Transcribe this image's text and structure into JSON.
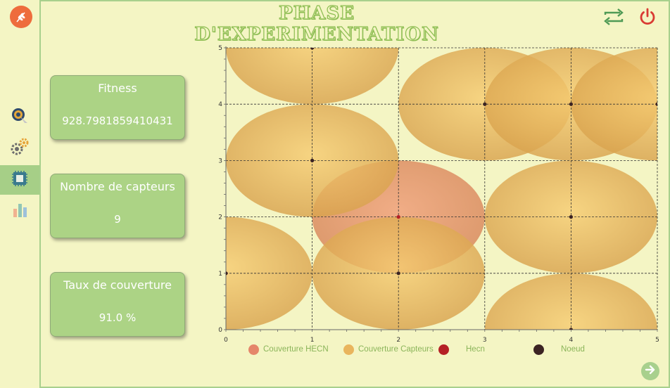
{
  "header": {
    "title": "PHASE D'EXPERIMENTATION"
  },
  "icons": {
    "logo": "wheat-logo-icon",
    "swap": "swap-arrows-icon",
    "power": "power-icon",
    "next": "arrow-right-icon"
  },
  "sidebar": {
    "items": [
      {
        "icon": "target-icon",
        "active": false
      },
      {
        "icon": "gears-icon",
        "active": false
      },
      {
        "icon": "chip-icon",
        "active": true
      },
      {
        "icon": "bar-chart-icon",
        "active": false
      }
    ]
  },
  "stats": {
    "fitness": {
      "label": "Fitness",
      "value": "928.7981859410431"
    },
    "sensors": {
      "label": "Nombre de capteurs",
      "value": "9"
    },
    "coverage": {
      "label": "Taux de couverture",
      "value": "91.0 %"
    }
  },
  "colors": {
    "accent": "#a8d08d",
    "background": "#f4f5c4",
    "card": "#acd385",
    "hecn_coverage": "#e5866a",
    "sensor_coverage": "#e9b55d",
    "hecn": "#b52025",
    "node": "#3b2323"
  },
  "chart_data": {
    "type": "scatter",
    "xlim": [
      0,
      5
    ],
    "ylim": [
      0,
      5
    ],
    "xticks": [
      "0",
      "1",
      "2",
      "3",
      "4",
      "5"
    ],
    "yticks": [
      "0",
      "1",
      "2",
      "3",
      "4",
      "5"
    ],
    "grid": true,
    "legend_position": "bottom",
    "coverage_radius": 1,
    "series": [
      {
        "name": "Couverture HECN",
        "kind": "coverage",
        "points": [
          [
            2,
            2
          ]
        ]
      },
      {
        "name": "Couverture Capteurs",
        "kind": "coverage",
        "points": [
          [
            1,
            5
          ],
          [
            1,
            3
          ],
          [
            0,
            1
          ],
          [
            2,
            1
          ],
          [
            3,
            4
          ],
          [
            4,
            4
          ],
          [
            5,
            4
          ],
          [
            4,
            2
          ],
          [
            4,
            0
          ]
        ]
      },
      {
        "name": "Hecn",
        "kind": "point",
        "points": [
          [
            2,
            2
          ]
        ]
      },
      {
        "name": "Noeud",
        "kind": "point",
        "points": [
          [
            1,
            5
          ],
          [
            1,
            3
          ],
          [
            0,
            1
          ],
          [
            2,
            1
          ],
          [
            3,
            4
          ],
          [
            4,
            4
          ],
          [
            5,
            4
          ],
          [
            4,
            2
          ],
          [
            4,
            0
          ]
        ]
      }
    ]
  }
}
